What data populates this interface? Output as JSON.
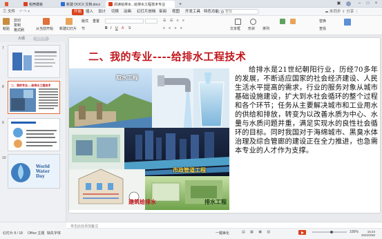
{
  "tabs": [
    {
      "label": "稻壳模板",
      "color": "#d9411e"
    },
    {
      "label": "新建 DOCX 文档.docx",
      "color": "#2b6fd6"
    },
    {
      "label": "阅读给排水...给排水工程技术专业",
      "color": "#d9411e"
    }
  ],
  "menu": {
    "file": "三 文件",
    "start": "开始",
    "items": [
      "插入",
      "设计",
      "切换",
      "动画",
      "幻灯片放映",
      "审阅",
      "视图",
      "开发工具",
      "特色功能"
    ],
    "search_placeholder": "查找"
  },
  "ribbon": {
    "paste": "粘贴",
    "cut": "剪切",
    "copy": "复制",
    "format_painter": "格式刷",
    "from_current": "从当前开始",
    "new_slide": "新建幻灯片",
    "layout": "版式",
    "section": "节",
    "reset": "重置",
    "text_box": "文本框",
    "shape": "形状",
    "arrange": "排列",
    "replace": "替换",
    "find": "查找"
  },
  "left_pane": {
    "outline_tab": "大纲",
    "slides_tab": "幻灯片",
    "slide_numbers": [
      "7",
      "8",
      "9",
      "10"
    ],
    "thumb8_title": "二、我的专业----给排水工程技术",
    "thumb10_text": "World Water Day"
  },
  "slide": {
    "title": "二、我的专业----给排水工程技术",
    "body": "给排水是21世纪朝阳行业，历经70多年的发展，不断适应国家的社会经济建设、人民生活水平提高的需求，行业的服务对象从城市基础设施建设，扩大到水社会循环的整个过程和各个环节；任务从主要解决城市和工业用水的供给和排放，转变为以改善水质为中心、水量与水质问题并重，满足实现水的良性社会循环的目标。同时我国对于海绵城市、黑臭水体治理及综合管廊的建设正在全力推进，也急需本专业的人才作为支撑。",
    "labels": {
      "intake": "取水工程",
      "municipal": "市政管道工程",
      "building": "建筑给排水",
      "other": "排水工程"
    }
  },
  "status": {
    "slide_counter": "幻灯片 8 / 18",
    "theme": "Office 主题",
    "font_missing": "缺失字体",
    "notes_placeholder": "单击此处添加备注",
    "zoom": "100%",
    "ai_assist": "一键美化",
    "clock_time": "15:34",
    "clock_date": "2022/3/30"
  },
  "colors": {
    "accent": "#d9411e",
    "title_red": "#c0161c",
    "selected_thumb": "#e26a33"
  },
  "zoom_level": 0.55
}
